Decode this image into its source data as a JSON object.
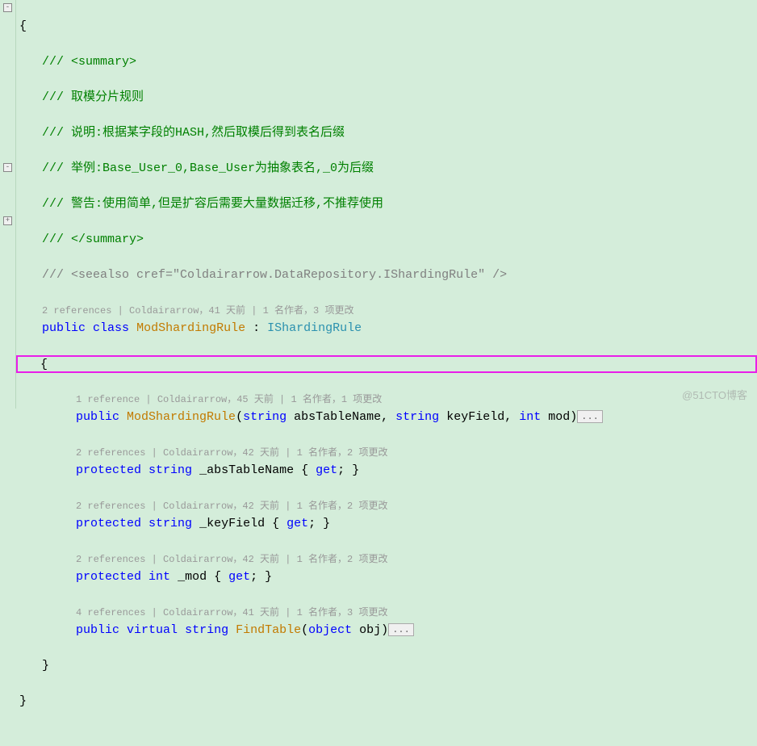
{
  "lines": {
    "l1": "{",
    "c1": "/// <summary>",
    "c2": "/// 取模分片规则",
    "c3": "/// 说明:根据某字段的HASH,然后取模后得到表名后缀",
    "c4": "/// 举例:Base_User_0,Base_User为抽象表名,_0为后缀",
    "c5": "/// 警告:使用简单,但是扩容后需要大量数据迁移,不推荐使用",
    "c6": "/// </summary>",
    "seealso_prefix": "/// <seealso cref=",
    "seealso_cref": "\"Coldairarrow.DataRepository.IShardingRule\"",
    "seealso_suffix": " />",
    "lens1": "2 references | Coldairarrow，41 天前 | 1 名作者，3 项更改",
    "kw_public": "public",
    "kw_class": "class",
    "kw_protected": "protected",
    "kw_virtual": "virtual",
    "kw_string": "string",
    "kw_int": "int",
    "kw_object": "object",
    "kw_get": "get",
    "classname": "ModShardingRule",
    "colon": " : ",
    "interface": "IShardingRule",
    "brace_open": "{",
    "brace_close": "}",
    "lens2": "1 reference | Coldairarrow，45 天前 | 1 名作者，1 项更改",
    "ctor": "ModShardingRule",
    "param_abs": "absTableName",
    "param_key": "keyField",
    "param_mod": "mod",
    "lens3": "2 references | Coldairarrow，42 天前 | 1 名作者，2 项更改",
    "prop_abs": "_absTableName",
    "lens4": "2 references | Coldairarrow，42 天前 | 1 名作者，2 项更改",
    "prop_key": "_keyField",
    "lens5": "2 references | Coldairarrow，42 天前 | 1 名作者，2 项更改",
    "prop_mod": "_mod",
    "lens6": "4 references | Coldairarrow，41 天前 | 1 名作者，3 项更改",
    "method_find": "FindTable",
    "param_obj": "obj",
    "collapsed": "..."
  },
  "watermark": "@51CTO博客"
}
